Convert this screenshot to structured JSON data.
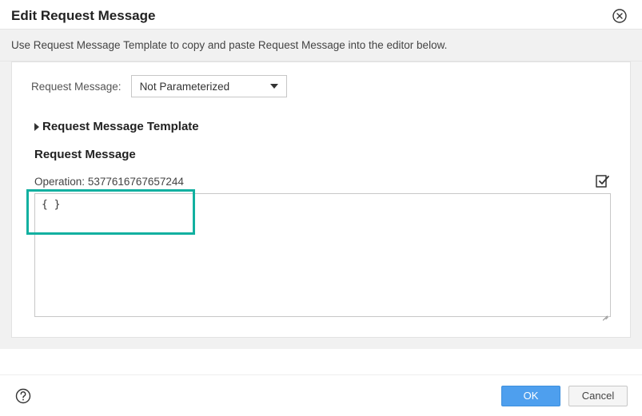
{
  "dialog": {
    "title": "Edit Request Message",
    "instruction": "Use Request Message Template to copy and paste Request Message into the editor below."
  },
  "form": {
    "request_message_label": "Request Message:",
    "parameter_select_value": "Not Parameterized",
    "template_header": "Request Message Template",
    "section_title": "Request Message",
    "operation_label": "Operation:",
    "operation_value": "5377616767657244",
    "editor_value": "{ }"
  },
  "footer": {
    "ok": "OK",
    "cancel": "Cancel"
  }
}
